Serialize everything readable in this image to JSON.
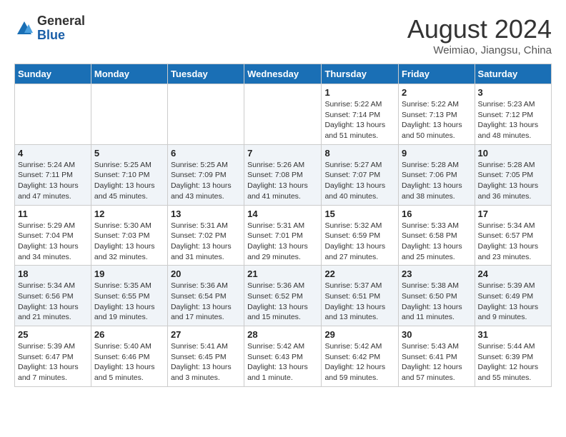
{
  "header": {
    "logo_general": "General",
    "logo_blue": "Blue",
    "month": "August 2024",
    "location": "Weimiao, Jiangsu, China"
  },
  "days_of_week": [
    "Sunday",
    "Monday",
    "Tuesday",
    "Wednesday",
    "Thursday",
    "Friday",
    "Saturday"
  ],
  "weeks": [
    [
      {
        "day": "",
        "info": ""
      },
      {
        "day": "",
        "info": ""
      },
      {
        "day": "",
        "info": ""
      },
      {
        "day": "",
        "info": ""
      },
      {
        "day": "1",
        "info": "Sunrise: 5:22 AM\nSunset: 7:14 PM\nDaylight: 13 hours and 51 minutes."
      },
      {
        "day": "2",
        "info": "Sunrise: 5:22 AM\nSunset: 7:13 PM\nDaylight: 13 hours and 50 minutes."
      },
      {
        "day": "3",
        "info": "Sunrise: 5:23 AM\nSunset: 7:12 PM\nDaylight: 13 hours and 48 minutes."
      }
    ],
    [
      {
        "day": "4",
        "info": "Sunrise: 5:24 AM\nSunset: 7:11 PM\nDaylight: 13 hours and 47 minutes."
      },
      {
        "day": "5",
        "info": "Sunrise: 5:25 AM\nSunset: 7:10 PM\nDaylight: 13 hours and 45 minutes."
      },
      {
        "day": "6",
        "info": "Sunrise: 5:25 AM\nSunset: 7:09 PM\nDaylight: 13 hours and 43 minutes."
      },
      {
        "day": "7",
        "info": "Sunrise: 5:26 AM\nSunset: 7:08 PM\nDaylight: 13 hours and 41 minutes."
      },
      {
        "day": "8",
        "info": "Sunrise: 5:27 AM\nSunset: 7:07 PM\nDaylight: 13 hours and 40 minutes."
      },
      {
        "day": "9",
        "info": "Sunrise: 5:28 AM\nSunset: 7:06 PM\nDaylight: 13 hours and 38 minutes."
      },
      {
        "day": "10",
        "info": "Sunrise: 5:28 AM\nSunset: 7:05 PM\nDaylight: 13 hours and 36 minutes."
      }
    ],
    [
      {
        "day": "11",
        "info": "Sunrise: 5:29 AM\nSunset: 7:04 PM\nDaylight: 13 hours and 34 minutes."
      },
      {
        "day": "12",
        "info": "Sunrise: 5:30 AM\nSunset: 7:03 PM\nDaylight: 13 hours and 32 minutes."
      },
      {
        "day": "13",
        "info": "Sunrise: 5:31 AM\nSunset: 7:02 PM\nDaylight: 13 hours and 31 minutes."
      },
      {
        "day": "14",
        "info": "Sunrise: 5:31 AM\nSunset: 7:01 PM\nDaylight: 13 hours and 29 minutes."
      },
      {
        "day": "15",
        "info": "Sunrise: 5:32 AM\nSunset: 6:59 PM\nDaylight: 13 hours and 27 minutes."
      },
      {
        "day": "16",
        "info": "Sunrise: 5:33 AM\nSunset: 6:58 PM\nDaylight: 13 hours and 25 minutes."
      },
      {
        "day": "17",
        "info": "Sunrise: 5:34 AM\nSunset: 6:57 PM\nDaylight: 13 hours and 23 minutes."
      }
    ],
    [
      {
        "day": "18",
        "info": "Sunrise: 5:34 AM\nSunset: 6:56 PM\nDaylight: 13 hours and 21 minutes."
      },
      {
        "day": "19",
        "info": "Sunrise: 5:35 AM\nSunset: 6:55 PM\nDaylight: 13 hours and 19 minutes."
      },
      {
        "day": "20",
        "info": "Sunrise: 5:36 AM\nSunset: 6:54 PM\nDaylight: 13 hours and 17 minutes."
      },
      {
        "day": "21",
        "info": "Sunrise: 5:36 AM\nSunset: 6:52 PM\nDaylight: 13 hours and 15 minutes."
      },
      {
        "day": "22",
        "info": "Sunrise: 5:37 AM\nSunset: 6:51 PM\nDaylight: 13 hours and 13 minutes."
      },
      {
        "day": "23",
        "info": "Sunrise: 5:38 AM\nSunset: 6:50 PM\nDaylight: 13 hours and 11 minutes."
      },
      {
        "day": "24",
        "info": "Sunrise: 5:39 AM\nSunset: 6:49 PM\nDaylight: 13 hours and 9 minutes."
      }
    ],
    [
      {
        "day": "25",
        "info": "Sunrise: 5:39 AM\nSunset: 6:47 PM\nDaylight: 13 hours and 7 minutes."
      },
      {
        "day": "26",
        "info": "Sunrise: 5:40 AM\nSunset: 6:46 PM\nDaylight: 13 hours and 5 minutes."
      },
      {
        "day": "27",
        "info": "Sunrise: 5:41 AM\nSunset: 6:45 PM\nDaylight: 13 hours and 3 minutes."
      },
      {
        "day": "28",
        "info": "Sunrise: 5:42 AM\nSunset: 6:43 PM\nDaylight: 13 hours and 1 minute."
      },
      {
        "day": "29",
        "info": "Sunrise: 5:42 AM\nSunset: 6:42 PM\nDaylight: 12 hours and 59 minutes."
      },
      {
        "day": "30",
        "info": "Sunrise: 5:43 AM\nSunset: 6:41 PM\nDaylight: 12 hours and 57 minutes."
      },
      {
        "day": "31",
        "info": "Sunrise: 5:44 AM\nSunset: 6:39 PM\nDaylight: 12 hours and 55 minutes."
      }
    ]
  ]
}
